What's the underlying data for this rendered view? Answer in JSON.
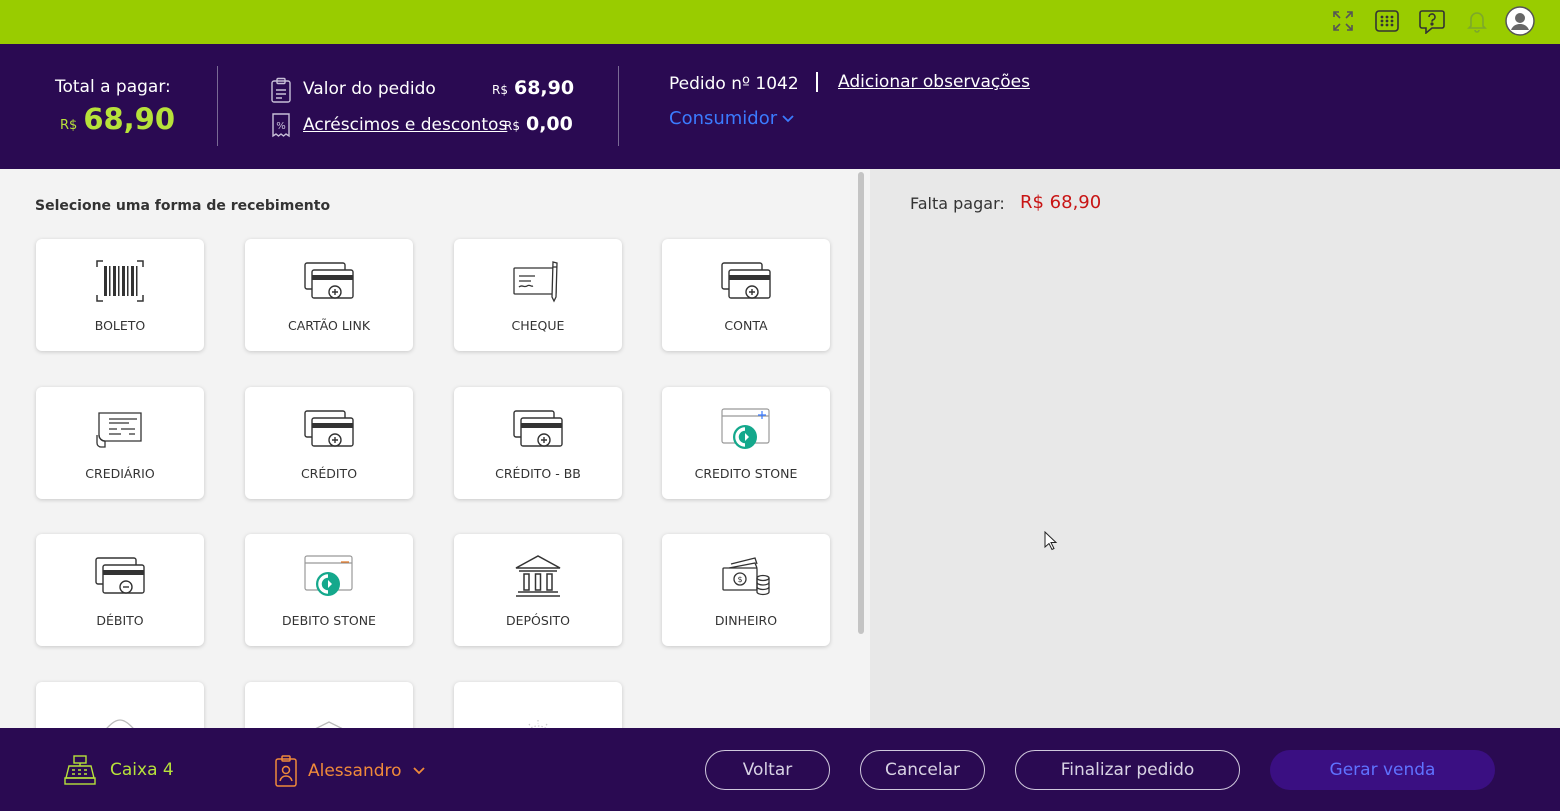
{
  "topbar": {
    "icons": [
      "fullscreen-icon",
      "apps-grid-icon",
      "help-chat-icon",
      "bell-icon",
      "user-avatar-icon"
    ]
  },
  "header": {
    "total_label": "Total a pagar:",
    "total_currency": "R$",
    "total_amount": "68,90",
    "order_value_label": "Valor do pedido",
    "order_value_currency": "R$",
    "order_value": "68,90",
    "adjust_label": "Acréscimos e descontos",
    "adjust_currency": "R$",
    "adjust_value": "0,00",
    "order_number": "Pedido nº 1042",
    "add_notes": "Adicionar observações",
    "customer": "Consumidor"
  },
  "payments": {
    "title": "Selecione uma forma de recebimento",
    "methods": [
      {
        "label": "BOLETO",
        "icon": "barcode-icon"
      },
      {
        "label": "CARTÃO LINK",
        "icon": "card-plus-icon"
      },
      {
        "label": "CHEQUE",
        "icon": "cheque-icon"
      },
      {
        "label": "CONTA",
        "icon": "card-plus-icon"
      },
      {
        "label": "CREDIÁRIO",
        "icon": "credit-book-icon"
      },
      {
        "label": "CRÉDITO",
        "icon": "card-plus-icon"
      },
      {
        "label": "CRÉDITO - BB",
        "icon": "card-plus-icon"
      },
      {
        "label": "CREDITO STONE",
        "icon": "stone-icon"
      },
      {
        "label": "DÉBITO",
        "icon": "card-minus-icon"
      },
      {
        "label": "DEBITO STONE",
        "icon": "stone-icon"
      },
      {
        "label": "DEPÓSITO",
        "icon": "bank-icon"
      },
      {
        "label": "DINHEIRO",
        "icon": "cash-icon"
      }
    ]
  },
  "summary": {
    "remaining_label": "Falta pagar:",
    "remaining_value": "R$ 68,90"
  },
  "footer": {
    "register": "Caixa 4",
    "user": "Alessandro",
    "back": "Voltar",
    "cancel": "Cancelar",
    "finish": "Finalizar pedido",
    "generate": "Gerar venda"
  },
  "colors": {
    "topbar": "#99cc00",
    "header": "#2a0a52",
    "accent_green": "#b7e23a",
    "accent_blue": "#3b7bff",
    "accent_orange": "#f08a3a",
    "alert_red": "#c81414",
    "stone_green": "#14a88c"
  }
}
